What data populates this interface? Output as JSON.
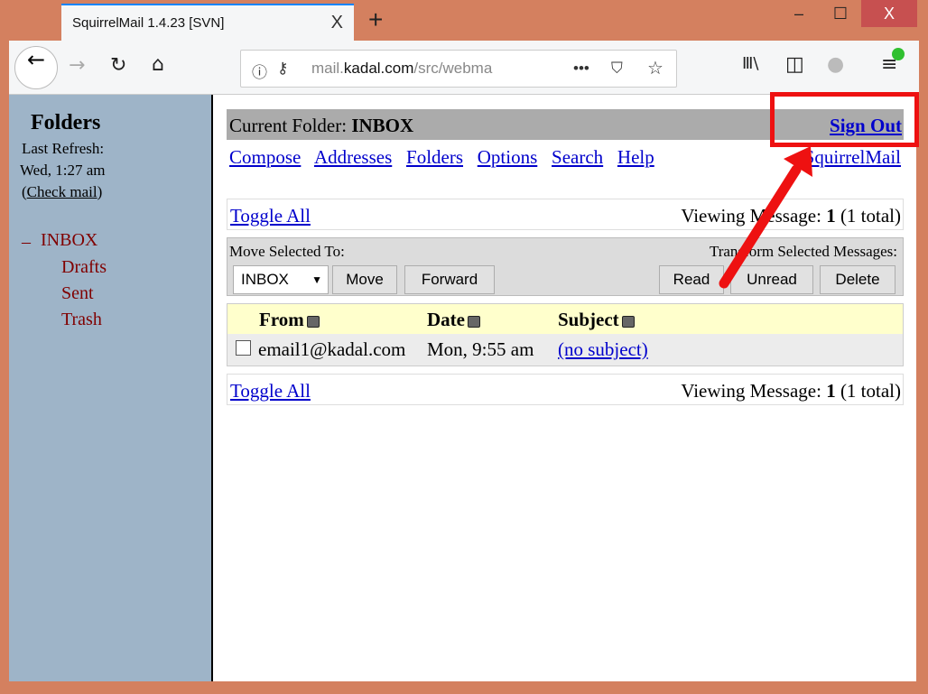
{
  "browser": {
    "tab_title": "SquirrelMail 1.4.23 [SVN]",
    "url_domain": "mail.kadal.com",
    "url_path": "/src/webma",
    "url_prefix": "mail.",
    "url_host": "kadal.com",
    "minimize": "–",
    "maximize": "☐",
    "close": "X",
    "new_tab": "+",
    "tab_close": "X"
  },
  "sidebar": {
    "title": "Folders",
    "last_refresh_label": "Last Refresh:",
    "last_refresh": "Wed, 1:27 am",
    "check_mail": "Check mail",
    "collapse": "–",
    "folders": [
      "INBOX",
      "Drafts",
      "Sent",
      "Trash"
    ]
  },
  "header": {
    "current_folder_label": "Current Folder:",
    "current_folder": "INBOX",
    "sign_out": "Sign Out",
    "brand_link": "SquirrelMail"
  },
  "nav": [
    "Compose",
    "Addresses",
    "Folders",
    "Options",
    "Search",
    "Help"
  ],
  "toggle_all": "Toggle All",
  "viewing": {
    "label": "Viewing Message:",
    "current": "1",
    "total": "(1 total)"
  },
  "actions": {
    "move_label": "Move Selected To:",
    "folder_select": "INBOX",
    "move": "Move",
    "forward": "Forward",
    "transform_label": "Transform Selected Messages:",
    "read": "Read",
    "unread": "Unread",
    "delete": "Delete"
  },
  "columns": [
    "From",
    "Date",
    "Subject"
  ],
  "messages": [
    {
      "from": "email1@kadal.com",
      "date": "Mon, 9:55 am",
      "subject": "(no subject)"
    }
  ],
  "colors": {
    "frame": "#d4805f",
    "sidebar": "#9eb4c8",
    "folder": "#800000",
    "link": "#0000cc",
    "header_bar": "#ababab",
    "highlight": "#ee1111"
  }
}
